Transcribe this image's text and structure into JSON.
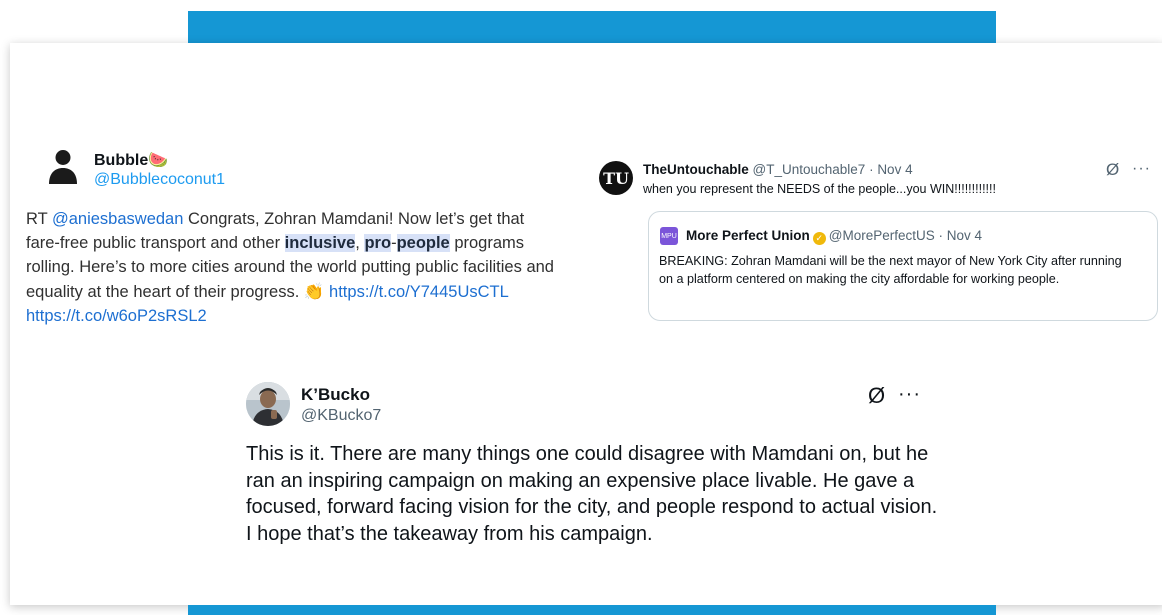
{
  "colors": {
    "accent_bar": "#1597d4",
    "link": "#1d9bf0",
    "highlight": "#d7e1f7"
  },
  "tweet1": {
    "name": "Bubble",
    "name_emoji": "🍉",
    "handle": "@Bubblecoconut1",
    "body": {
      "rt": "RT ",
      "mention": "@aniesbaswedan",
      "text1": " Congrats, Zohran Mamdani! Now let’s get that fare-free public transport and other ",
      "hl1": "inclusive",
      "comma": ",",
      "hl2": "pro",
      "dash": "-",
      "hl3": "people",
      "text2": " programs rolling. Here’s to more cities around the world putting public facilities and equality at the heart of their progress. ",
      "clap": "👏",
      "link1": "https://t.co/Y7445UsCTL",
      "link2": "https://t.co/w6oP2sRSL2"
    }
  },
  "tweet2": {
    "avatar_text": "TU",
    "name": "TheUntouchable",
    "handle": "@T_Untouchable7",
    "sep": " · ",
    "date": "Nov 4",
    "text": "when you represent the NEEDS of the people...you WIN!!!!!!!!!!!!",
    "grok_icon": "Ø",
    "more_icon": "···",
    "quote": {
      "avatar_text": "MPU",
      "name": "More Perfect Union",
      "badge": "✓",
      "handle": "@MorePerfectUS",
      "sep": " · ",
      "date": "Nov 4",
      "text": "BREAKING: Zohran Mamdani will be the next mayor of New York City after running on a platform centered on making the city affordable for working people."
    }
  },
  "tweet3": {
    "name": "K’Bucko",
    "handle": "@KBucko7",
    "grok_icon": "Ø",
    "more_icon": "···",
    "body": "This is it. There are many things one could disagree with Mamdani on, but he ran an inspiring campaign on making an expensive place livable. He gave a focused, forward facing vision for the city, and people respond to actual vision. I hope that’s the takeaway from his campaign."
  }
}
